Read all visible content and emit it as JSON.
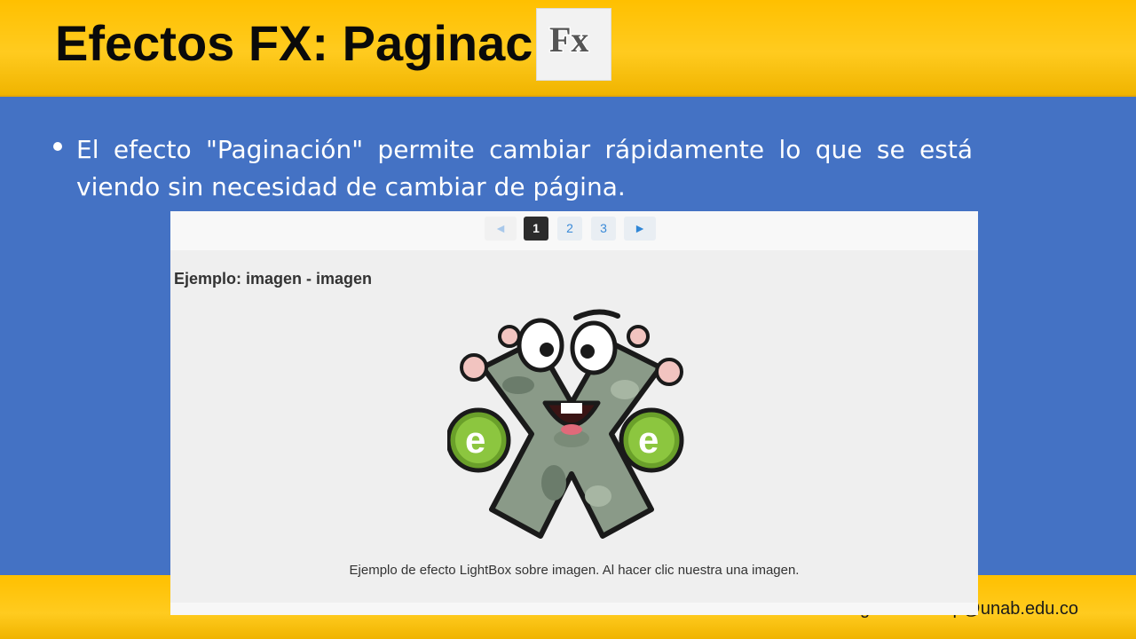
{
  "slide": {
    "title": "Efectos FX: Paginación",
    "bullet": "El efecto \"Paginación\" permite cambiar rápidamente lo que se está viendo sin necesidad de cambiar de página.",
    "footer": "Ricardo Arciniegas · rarcinip@unab.edu.co"
  },
  "fx_logo": {
    "text": "Fx"
  },
  "embedded_page": {
    "pagination": {
      "prev_symbol": "◄",
      "pages": [
        "1",
        "2",
        "3"
      ],
      "active_page": "1",
      "next_symbol": "►"
    },
    "example_heading": "Ejemplo: imagen - imagen",
    "caption": "Ejemplo de efecto LightBox sobre imagen. Al hacer clic nuestra una imagen."
  },
  "colors": {
    "band_yellow": "#ffc000",
    "slide_blue": "#4472c4",
    "active_page_bg": "#2c2c2c",
    "link_blue": "#3a8ad8",
    "mascot_green": "#6aa02a"
  },
  "icons": [
    "fx-logo-icon",
    "prev-arrow-icon",
    "next-arrow-icon",
    "exe-mascot-image"
  ]
}
